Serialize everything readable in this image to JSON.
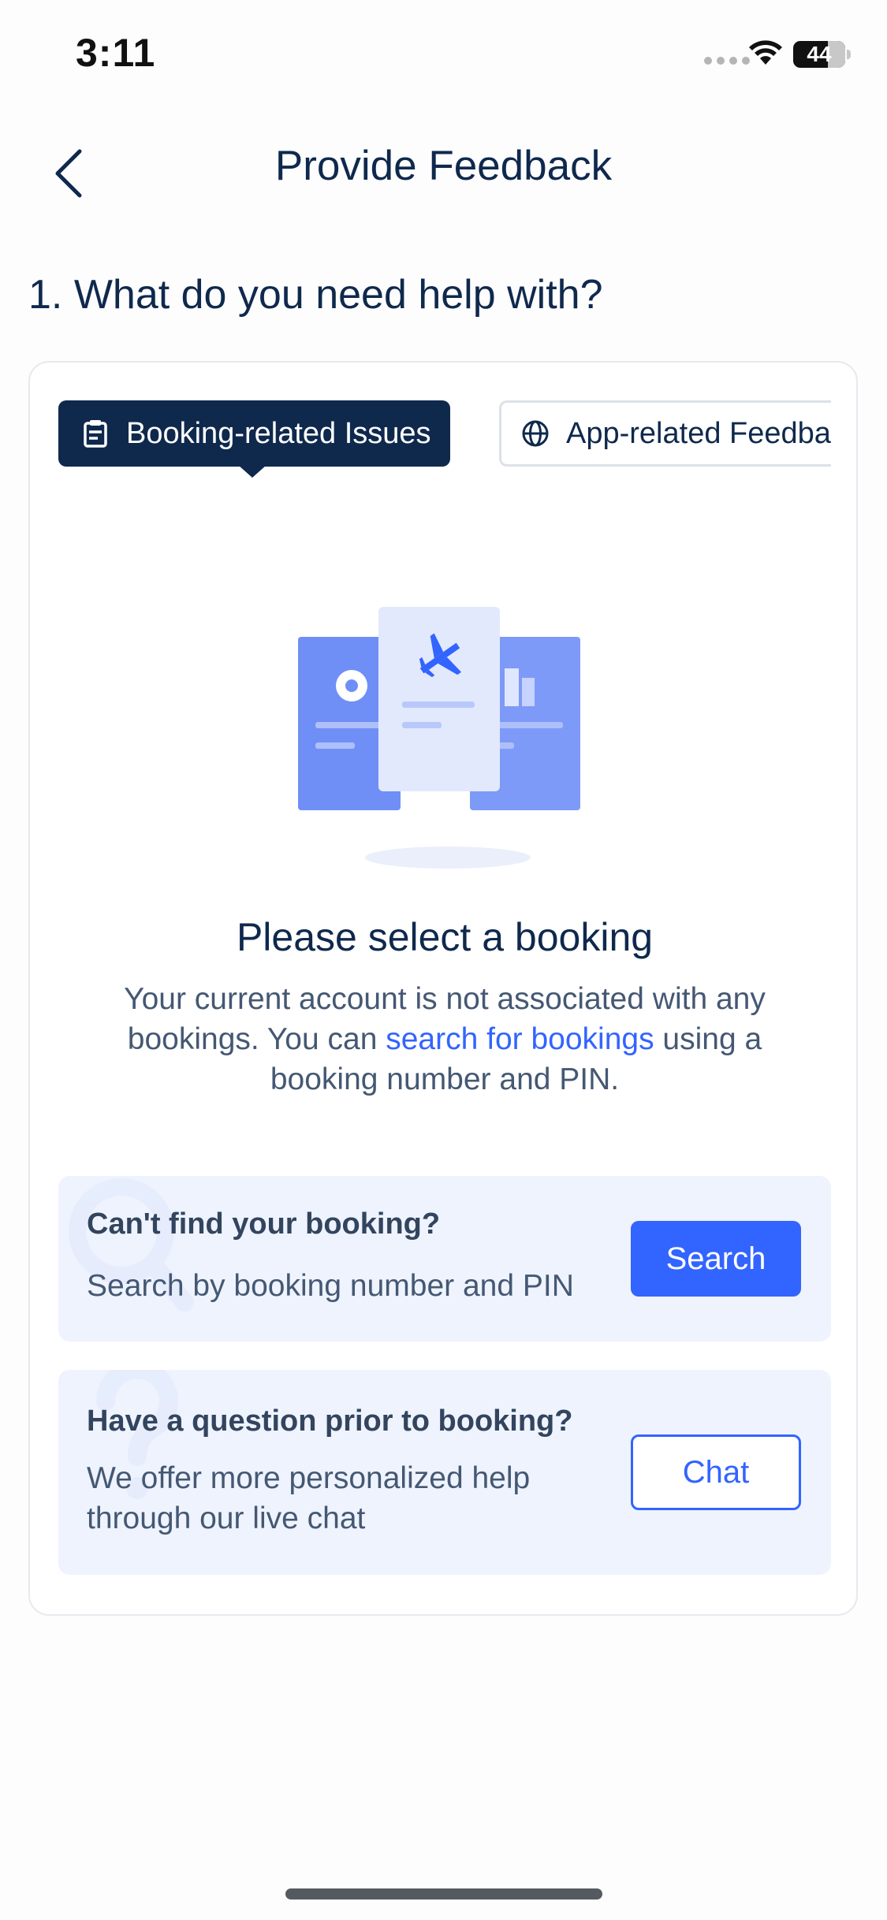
{
  "status_bar": {
    "time": "3:11",
    "battery": "44",
    "wifi_icon": "wifi-icon",
    "signal_icon": "signal-dots-icon"
  },
  "nav": {
    "back_icon": "chevron-left-icon",
    "title": "Provide Feedback"
  },
  "section": {
    "title": "1. What do you need help with?"
  },
  "tabs": [
    {
      "label": "Booking-related Issues",
      "icon": "clipboard-icon",
      "active": true
    },
    {
      "label": "App-related Feedback",
      "icon": "globe-icon",
      "active": false
    }
  ],
  "empty_state": {
    "illustration": "tickets-illustration",
    "title": "Please select a booking",
    "desc_before": "Your current account is not associated with any bookings. You can ",
    "desc_link": "search for bookings",
    "desc_after": " using a booking number and PIN."
  },
  "help_search": {
    "title": "Can't find your booking?",
    "subtitle": "Search by booking number and PIN",
    "button": "Search"
  },
  "help_chat": {
    "title": "Have a question prior to booking?",
    "subtitle": "We offer more personalized help through our live chat",
    "button": "Chat"
  },
  "colors": {
    "primary": "#3264ff",
    "navy": "#0f294d",
    "help_bg": "#eef3fe"
  }
}
